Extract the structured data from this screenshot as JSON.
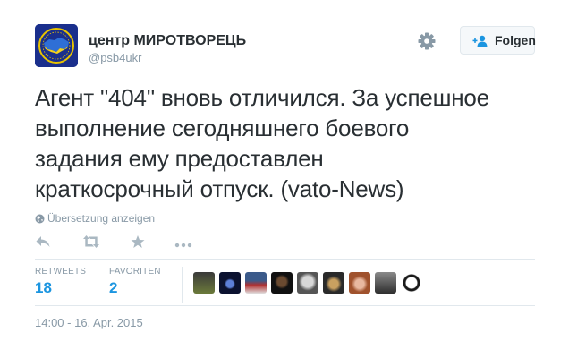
{
  "author": {
    "display_name": "центр МИРОТВОРЕЦЬ",
    "handle": "@psb4ukr",
    "avatar": "ukraine-map-emblem"
  },
  "follow_button": {
    "label": "Folgen",
    "icon": "add-user-icon"
  },
  "settings_icon": "gear-icon",
  "tweet": {
    "text": "Агент \"404\" вновь отличился. За успешное\nвыполнение сегодняшнего боевого\nзадания  ему предоставлен\nкраткосрочный отпуск. (vato-News)"
  },
  "translate_link": "Übersetzung anzeigen",
  "actions": [
    "reply-icon",
    "retweet-icon",
    "favorite-icon",
    "more-icon"
  ],
  "stats": {
    "retweets_label": "RETWEETS",
    "retweets_value": "18",
    "favorites_label": "FAVORITEN",
    "favorites_value": "2"
  },
  "timestamp": "14:00 - 16. Apr. 2015",
  "colors": {
    "text": "#292f33",
    "muted": "#8899a6",
    "accent": "#1b95e0",
    "border": "#e1e8ed"
  }
}
